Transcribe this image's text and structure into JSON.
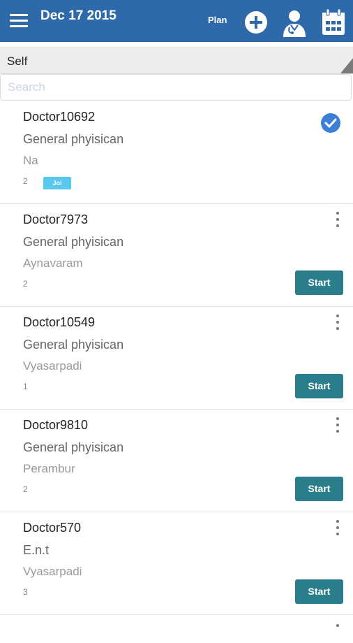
{
  "header": {
    "date": "Dec 17 2015",
    "plan_label": "Plan",
    "bg_color": "#2e6aa9",
    "icons": [
      "menu-icon",
      "add-icon",
      "doctor-icon",
      "calendar-icon"
    ]
  },
  "filter": {
    "selected": "Self"
  },
  "search": {
    "placeholder": "Search",
    "value": ""
  },
  "doctors": [
    {
      "name": "Doctor10692",
      "specialty": "General phyisican",
      "area": "Na",
      "count": "2",
      "badge": "Joi",
      "status": "checked"
    },
    {
      "name": "Doctor7973",
      "specialty": "General phyisican",
      "area": "Aynavaram",
      "count": "2",
      "action": "Start"
    },
    {
      "name": "Doctor10549",
      "specialty": "General phyisican",
      "area": "Vyasarpadi",
      "count": "1",
      "action": "Start"
    },
    {
      "name": "Doctor9810",
      "specialty": "General phyisican",
      "area": "Perambur",
      "count": "2",
      "action": "Start"
    },
    {
      "name": "Doctor570",
      "specialty": "E.n.t",
      "area": "Vyasarpadi",
      "count": "3",
      "action": "Start"
    }
  ],
  "colors": {
    "header": "#2e6aa9",
    "start_button": "#2a7d8a",
    "badge": "#59c8ee",
    "check": "#3b7fd6"
  }
}
